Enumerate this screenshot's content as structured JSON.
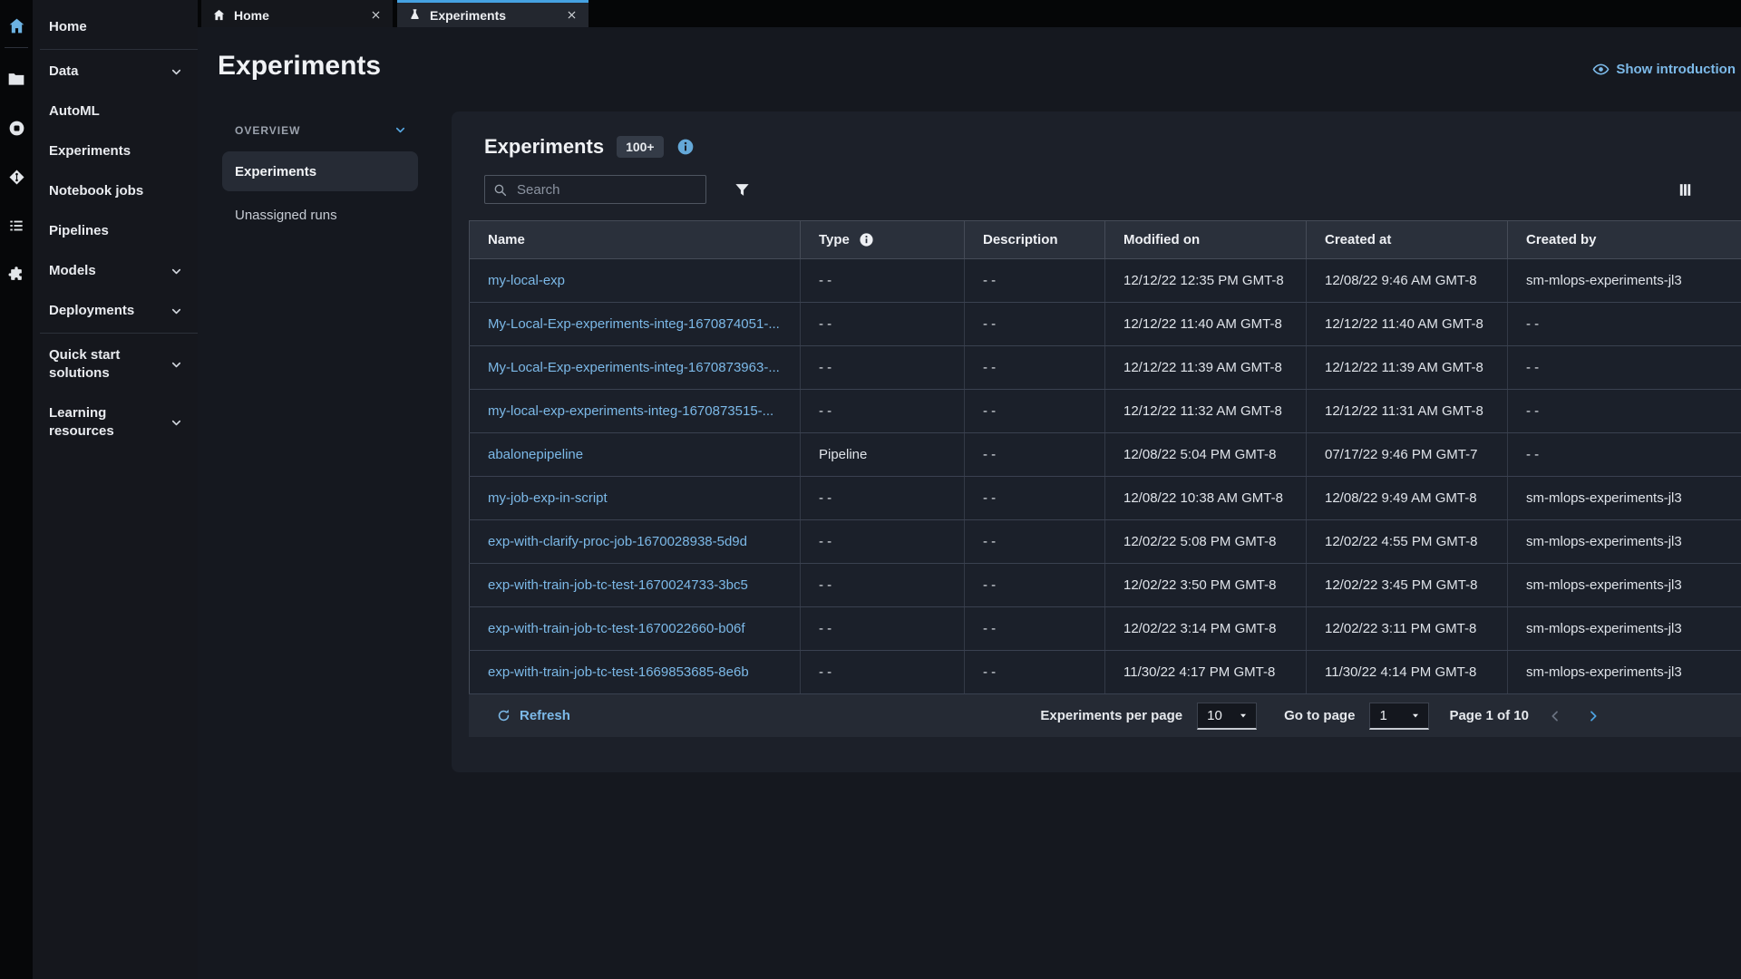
{
  "colors": {
    "accent_blue": "#45a2e2",
    "link_blue": "#7cb9e8",
    "rail_bg": "#060709",
    "sidebar_bg": "#15171d",
    "page_bg": "#15181f",
    "panel_bg": "#1c2029",
    "table_header_bg": "#2a303b",
    "row_bg": "#1b202a",
    "footer_bg": "#252a34",
    "badge_bg": "#343b47"
  },
  "tabs": [
    {
      "label": "Home",
      "icon": "home-icon",
      "active": false
    },
    {
      "label": "Experiments",
      "icon": "flask-icon",
      "active": true
    }
  ],
  "sidebar": {
    "rail_icons": [
      "home-icon",
      "folder-icon",
      "running-circle-icon",
      "git-icon",
      "list-icon",
      "puzzle-icon"
    ],
    "items": [
      {
        "label": "Home"
      },
      {
        "label": "Data",
        "expandable": true,
        "divider_before": true
      },
      {
        "label": "AutoML"
      },
      {
        "label": "Experiments"
      },
      {
        "label": "Notebook jobs"
      },
      {
        "label": "Pipelines"
      },
      {
        "label": "Models",
        "expandable": true
      },
      {
        "label": "Deployments",
        "expandable": true
      },
      {
        "label": "Quick start solutions",
        "expandable": true,
        "divider_before": true
      },
      {
        "label": "Learning resources",
        "expandable": true
      }
    ]
  },
  "page": {
    "title": "Experiments",
    "show_introduction_label": "Show introduction"
  },
  "subnav": {
    "section_label": "OVERVIEW",
    "items": [
      {
        "label": "Experiments",
        "selected": true
      },
      {
        "label": "Unassigned runs",
        "selected": false
      }
    ]
  },
  "panel": {
    "title": "Experiments",
    "count_badge": "100+",
    "search_placeholder": "Search",
    "table": {
      "columns": [
        {
          "label": "Name"
        },
        {
          "label": "Type",
          "info": true
        },
        {
          "label": "Description"
        },
        {
          "label": "Modified on"
        },
        {
          "label": "Created at"
        },
        {
          "label": "Created by"
        }
      ],
      "rows": [
        [
          "my-local-exp",
          "- -",
          "- -",
          "12/12/22 12:35 PM GMT-8",
          "12/08/22 9:46 AM GMT-8",
          "sm-mlops-experiments-jl3"
        ],
        [
          "My-Local-Exp-experiments-integ-1670874051-...",
          "- -",
          "- -",
          "12/12/22 11:40 AM GMT-8",
          "12/12/22 11:40 AM GMT-8",
          "- -"
        ],
        [
          "My-Local-Exp-experiments-integ-1670873963-...",
          "- -",
          "- -",
          "12/12/22 11:39 AM GMT-8",
          "12/12/22 11:39 AM GMT-8",
          "- -"
        ],
        [
          "my-local-exp-experiments-integ-1670873515-...",
          "- -",
          "- -",
          "12/12/22 11:32 AM GMT-8",
          "12/12/22 11:31 AM GMT-8",
          "- -"
        ],
        [
          "abalonepipeline",
          "Pipeline",
          "- -",
          "12/08/22 5:04 PM GMT-8",
          "07/17/22 9:46 PM GMT-7",
          "- -"
        ],
        [
          "my-job-exp-in-script",
          "- -",
          "- -",
          "12/08/22 10:38 AM GMT-8",
          "12/08/22 9:49 AM GMT-8",
          "sm-mlops-experiments-jl3"
        ],
        [
          "exp-with-clarify-proc-job-1670028938-5d9d",
          "- -",
          "- -",
          "12/02/22 5:08 PM GMT-8",
          "12/02/22 4:55 PM GMT-8",
          "sm-mlops-experiments-jl3"
        ],
        [
          "exp-with-train-job-tc-test-1670024733-3bc5",
          "- -",
          "- -",
          "12/02/22 3:50 PM GMT-8",
          "12/02/22 3:45 PM GMT-8",
          "sm-mlops-experiments-jl3"
        ],
        [
          "exp-with-train-job-tc-test-1670022660-b06f",
          "- -",
          "- -",
          "12/02/22 3:14 PM GMT-8",
          "12/02/22 3:11 PM GMT-8",
          "sm-mlops-experiments-jl3"
        ],
        [
          "exp-with-train-job-tc-test-1669853685-8e6b",
          "- -",
          "- -",
          "11/30/22 4:17 PM GMT-8",
          "11/30/22 4:14 PM GMT-8",
          "sm-mlops-experiments-jl3"
        ]
      ]
    },
    "footer": {
      "refresh_label": "Refresh",
      "per_page_label": "Experiments per page",
      "per_page_value": "10",
      "goto_label": "Go to page",
      "goto_value": "1",
      "page_status": "Page 1 of 10"
    }
  }
}
